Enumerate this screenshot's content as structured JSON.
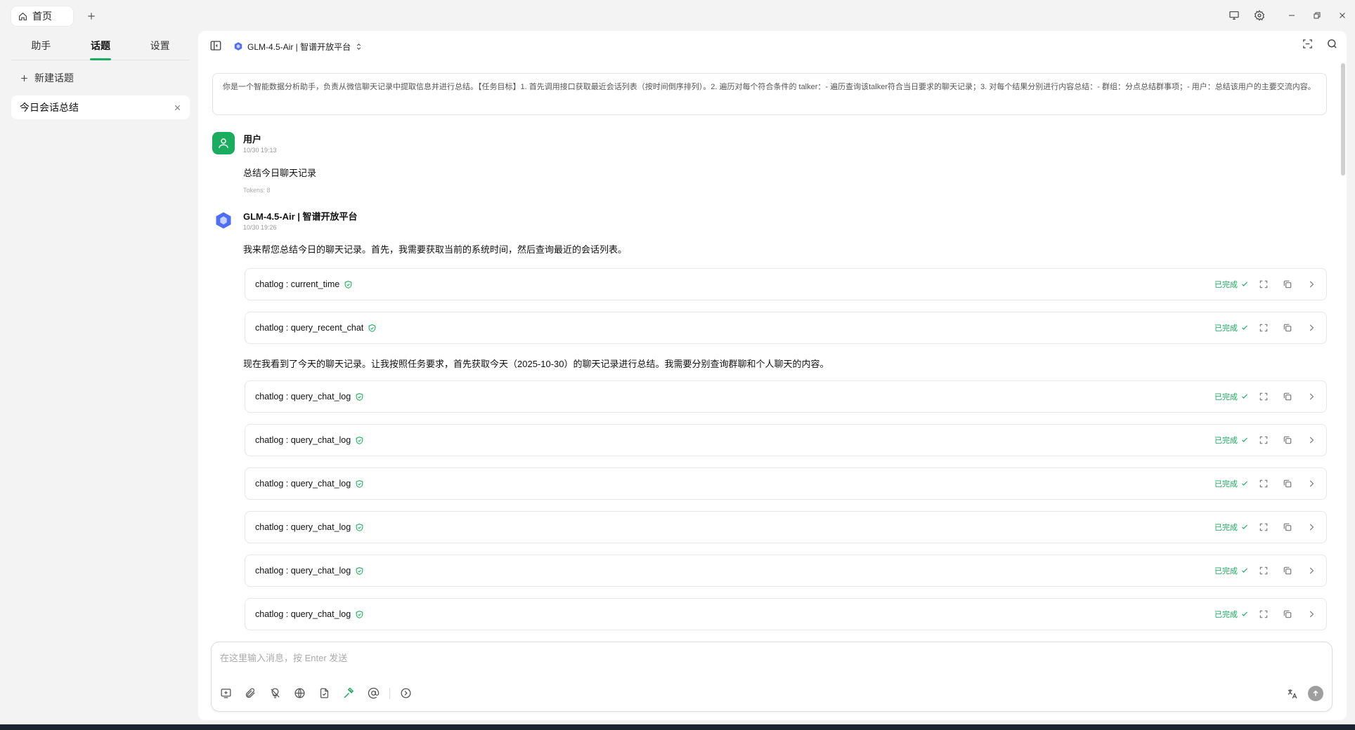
{
  "titlebar": {
    "home_tab_label": "首页"
  },
  "sidebar": {
    "tabs": [
      {
        "label": "助手"
      },
      {
        "label": "话题"
      },
      {
        "label": "设置"
      }
    ],
    "new_topic_label": "新建话题",
    "topics": [
      {
        "label": "今日会话总结"
      }
    ]
  },
  "header": {
    "model_name": "GLM-4.5-Air | 智谱开放平台"
  },
  "system_prompt": "你是一个智能数据分析助手，负责从微信聊天记录中提取信息并进行总结。【任务目标】1. 首先调用接口获取最近会话列表（按时间倒序排列）。2. 遍历对每个符合条件的 talker：- 遍历查询该talker符合当日要求的聊天记录；3. 对每个结果分别进行内容总结：- 群组：分点总结群事项；- 用户：总结该用户的主要交流内容。",
  "messages": {
    "user": {
      "name": "用户",
      "time": "10/30 19:13",
      "text": "总结今日聊天记录",
      "tokens": "Tokens: 8"
    },
    "assistant": {
      "name": "GLM-4.5-Air | 智谱开放平台",
      "time": "10/30 19:26",
      "intro": "我来帮您总结今日的聊天记录。首先，我需要获取当前的系统时间，然后查询最近的会话列表。",
      "middle": "现在我看到了今天的聊天记录。让我按照任务要求，首先获取今天（2025-10-30）的聊天记录进行总结。我需要分别查询群聊和个人聊天的内容。"
    }
  },
  "tool_calls": [
    {
      "label": "chatlog : current_time",
      "status": "已完成"
    },
    {
      "label": "chatlog : query_recent_chat",
      "status": "已完成"
    },
    {
      "label": "chatlog : query_chat_log",
      "status": "已完成"
    },
    {
      "label": "chatlog : query_chat_log",
      "status": "已完成"
    },
    {
      "label": "chatlog : query_chat_log",
      "status": "已完成"
    },
    {
      "label": "chatlog : query_chat_log",
      "status": "已完成"
    },
    {
      "label": "chatlog : query_chat_log",
      "status": "已完成"
    },
    {
      "label": "chatlog : query_chat_log",
      "status": "已完成"
    }
  ],
  "input": {
    "placeholder": "在这里输入消息，按 Enter 发送"
  },
  "colors": {
    "accent": "#1aad5f",
    "user_avatar": "#1aad5f",
    "taskbar": "#1c2331"
  }
}
